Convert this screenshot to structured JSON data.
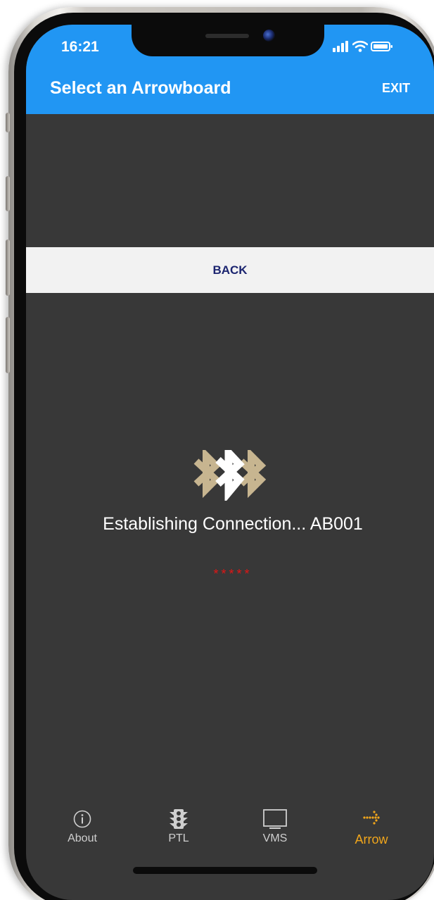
{
  "status_bar": {
    "time": "16:21"
  },
  "app_bar": {
    "title": "Select an Arrowboard",
    "exit_label": "EXIT"
  },
  "back_bar": {
    "label": "BACK"
  },
  "connection": {
    "message": "Establishing Connection... AB001",
    "progress_dots": "*****"
  },
  "tabs": [
    {
      "label": "About",
      "icon": "info-icon",
      "active": false
    },
    {
      "label": "PTL",
      "icon": "traffic-light-icon",
      "active": false
    },
    {
      "label": "VMS",
      "icon": "monitor-icon",
      "active": false
    },
    {
      "label": "Arrow",
      "icon": "arrow-board-icon",
      "active": true
    }
  ],
  "colors": {
    "primary": "#2196f3",
    "background": "#383838",
    "back_bar": "#f2f2f2",
    "back_text": "#1c2570",
    "bluetooth_gold": "#c7b590",
    "progress_red": "#e01616",
    "active_tab": "#f1a61b",
    "inactive_tab": "#cfcfcf"
  }
}
